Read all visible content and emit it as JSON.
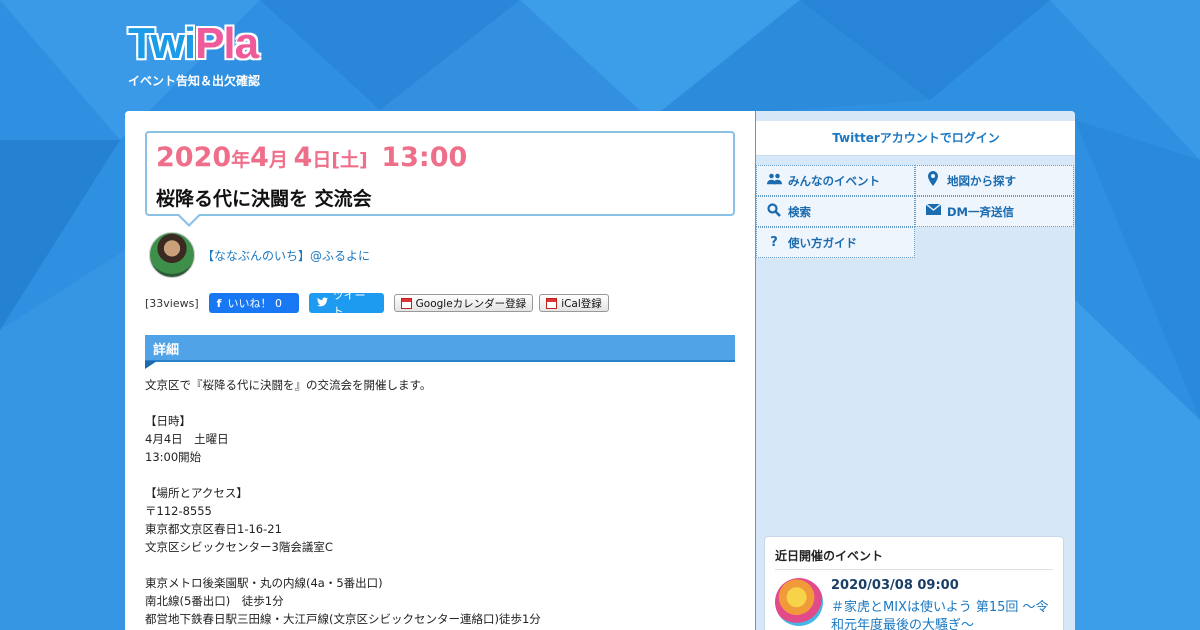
{
  "brand": {
    "name_part1": "Twi",
    "name_part2": "Pla",
    "tagline": "イベント告知＆出欠確認"
  },
  "event": {
    "year": "2020",
    "year_unit": "年",
    "month": "4",
    "month_unit": "月",
    "day": "4",
    "day_unit": "日",
    "weekday": "[土]",
    "time": "13:00",
    "title": "桜降る代に決闘を 交流会"
  },
  "organizer": {
    "name": "【ななぶんのいち】@ふるよに"
  },
  "actions": {
    "views": "[33views]",
    "like_label": "いいね！ 0",
    "like_icon": "f",
    "tweet_label": "ツイート",
    "google_calendar_label": "Googleカレンダー登録",
    "ical_label": "iCal登録"
  },
  "details": {
    "heading": "詳細",
    "lines": [
      "文京区で『桜降る代に決闘を』の交流会を開催します。",
      "",
      "【日時】",
      "4月4日　土曜日",
      "13:00開始",
      "",
      "【場所とアクセス】",
      "〒112-8555",
      "東京都文京区春日1-16-21",
      "文京区シビックセンター3階会議室C",
      "",
      "東京メトロ後楽園駅・丸の内線(4a・5番出口)",
      "南北線(5番出口)　徒歩1分",
      "都営地下鉄春日駅三田線・大江戸線(文京区シビックセンター連絡口)徒歩1分"
    ]
  },
  "sidebar": {
    "login_label": "Twitterアカウントでログイン",
    "menu": [
      {
        "label": "みんなのイベント",
        "icon": "users-icon"
      },
      {
        "label": "地図から探す",
        "icon": "map-pin-icon"
      },
      {
        "label": "検索",
        "icon": "search-icon"
      },
      {
        "label": "DM一斉送信",
        "icon": "mail-icon"
      },
      {
        "label": "使い方ガイド",
        "icon": "question-icon"
      }
    ],
    "recent": {
      "title": "近日開催のイベント",
      "items": [
        {
          "date": "2020/03/08 09:00",
          "name": "＃家虎とMIXは使いよう 第15回 ～令和元年度最後の大騒ぎ～"
        }
      ]
    }
  },
  "colors": {
    "background": "#2f8fe0",
    "date_pink": "#ef6f8a",
    "link_blue": "#1a78c2",
    "section_blue": "#4fa3e6"
  }
}
